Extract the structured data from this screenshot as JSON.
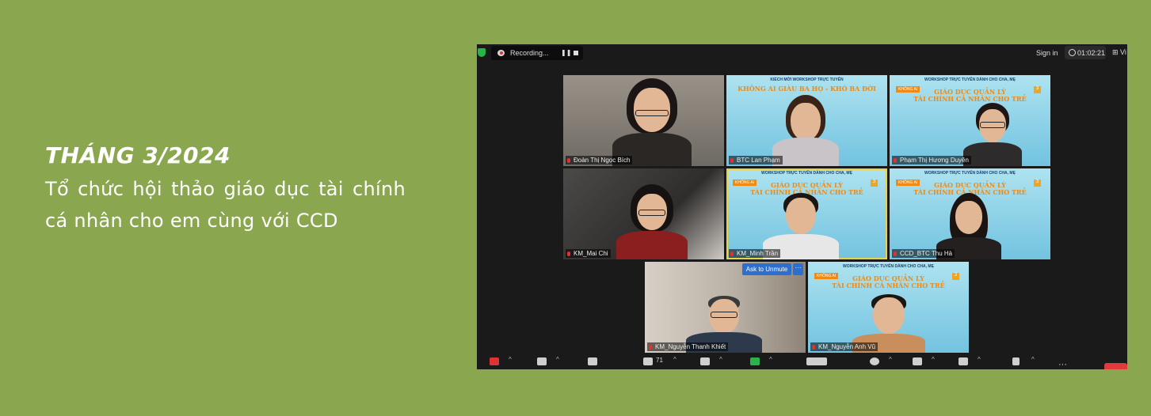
{
  "caption": {
    "date": "THÁNG 3/2024",
    "description": "Tổ chức hội thảo giáo dục tài chính cá nhân cho em cùng với CCD"
  },
  "meeting": {
    "recording_label": "Recording...",
    "sign_in": "Sign in",
    "timer": "01:02:21",
    "view": "Vi",
    "ask_to_unmute": "Ask to Unmute",
    "more": "···",
    "participants_count": "71",
    "participants": [
      {
        "name": "Đoàn Thị Ngọc Bích",
        "background": "photo"
      },
      {
        "name": "BTC Lan Phạm",
        "background": "banner"
      },
      {
        "name": "Phạm Thị Hương Duyên",
        "background": "banner"
      },
      {
        "name": "KM_Mai Chi",
        "background": "photo"
      },
      {
        "name": "KM_Minh Trần",
        "background": "banner"
      },
      {
        "name": "CCD_BTC Thu Hà",
        "background": "banner"
      },
      {
        "name": "KM_Nguyễn Thanh Khiết",
        "background": "photo"
      },
      {
        "name": "KM_Nguyễn Anh Vũ",
        "background": "banner"
      }
    ],
    "banner": {
      "org": "WORKSHOP TRỰC TUYẾN DÀNH CHO CHA, MẸ",
      "title_line1": "GIÁO DỤC QUẢN LÝ",
      "title_line2": "TÀI CHÍNH CÁ NHÂN CHO TRẺ",
      "tag": "KHÔNG AI",
      "alt_org": "KIỂCH MỜI WORKSHOP TRỰC TUYẾN",
      "alt_title": "KHÔNG AI GIÀU BA HỌ - KHÓ BA ĐỜI"
    },
    "colors": {
      "accent": "#2d6fd1",
      "end": "#e23a3a",
      "banner_title": "#f08a13",
      "active": "#e3d44c"
    }
  }
}
